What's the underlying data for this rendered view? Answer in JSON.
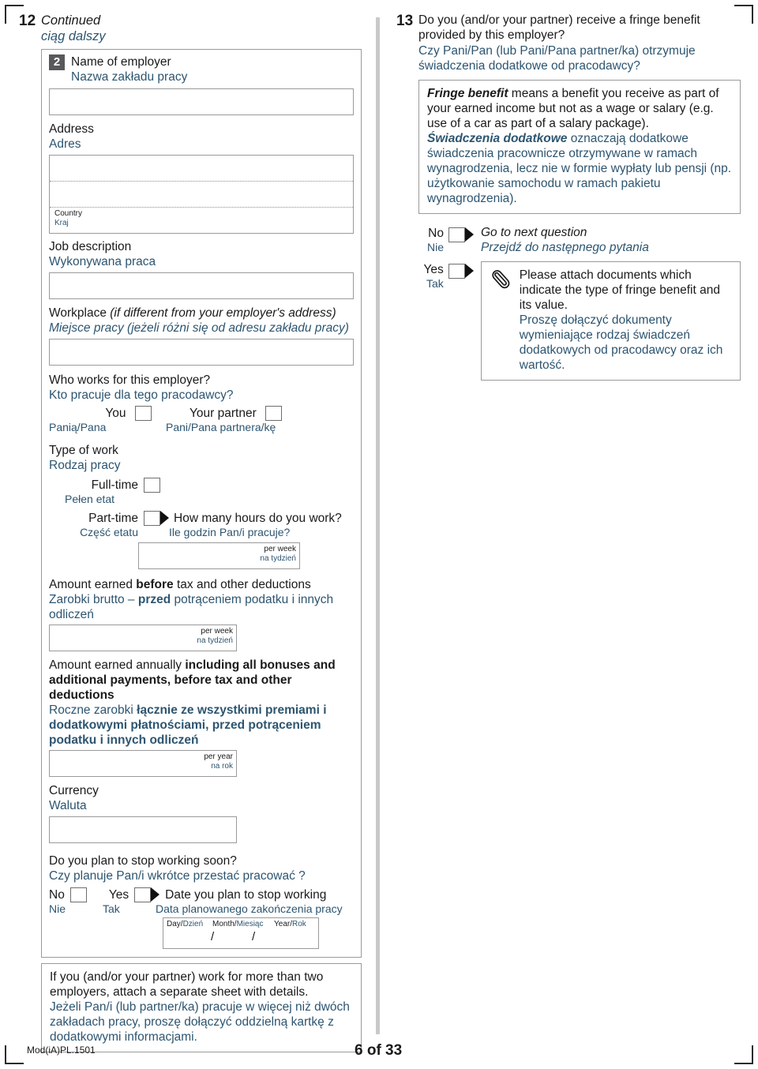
{
  "page": {
    "form_code": "Mod(iA)PL.1501",
    "page_label": "6 of 33"
  },
  "question12": {
    "number": "12",
    "title_en": "Continued",
    "title_pl": "ciąg dalszy",
    "sub_number": "2",
    "employer_name_en": "Name of employer",
    "employer_name_pl": "Nazwa zakładu pracy",
    "address_en": "Address",
    "address_pl": "Adres",
    "country_en": "Country",
    "country_pl": "Kraj",
    "job_description_en": "Job description",
    "job_description_pl": "Wykonywana praca",
    "workplace_en_bold": "Workplace",
    "workplace_en_italic": "(if different from your employer's address)",
    "workplace_pl": "Miejsce pracy (jeżeli różni się od adresu zakładu pracy)",
    "who_works_en": "Who works for this employer?",
    "who_works_pl": "Kto pracuje dla tego pracodawcy?",
    "you_en": "You",
    "you_pl": "Panią/Pana",
    "partner_en": "Your partner",
    "partner_pl": "Pani/Pana partnera/kę",
    "type_of_work_en": "Type of work",
    "type_of_work_pl": "Rodzaj pracy",
    "fulltime_en": "Full-time",
    "fulltime_pl": "Pełen etat",
    "parttime_en": "Part-time",
    "parttime_pl": "Część etatu",
    "hours_q_en": "How many hours do you work?",
    "hours_q_pl": "Ile godzin Pan/i pracuje?",
    "per_week_en": "per week",
    "per_week_pl": "na tydzień",
    "before_tax_en_1": "Amount earned ",
    "before_tax_en_bold": "before",
    "before_tax_en_2": " tax and other deductions",
    "before_tax_pl_1": "Zarobki brutto – ",
    "before_tax_pl_bold": "przed",
    "before_tax_pl_2": " potrąceniem podatku i innych odliczeń",
    "annual_en_1": "Amount earned annually ",
    "annual_en_bold": "including all bonuses and additional payments, before tax and other deductions",
    "annual_pl_1": "Roczne zarobki ",
    "annual_pl_bold": "łącznie ze wszystkimi premiami i dodatkowymi płatnościami, przed potrąceniem podatku i innych odliczeń",
    "per_year_en": "per year",
    "per_year_pl": "na rok",
    "currency_en": "Currency",
    "currency_pl": "Waluta",
    "stop_q_en": "Do you plan to stop working soon?",
    "stop_q_pl": "Czy planuje Pan/i wkrótce przestać pracować ?",
    "no_en": "No",
    "no_pl": "Nie",
    "yes_en": "Yes",
    "yes_pl": "Tak",
    "stop_date_en": "Date you plan to stop working",
    "stop_date_pl": "Data planowanego zakończenia pracy",
    "day_en": "Day/",
    "day_pl": "Dzień",
    "month_en": "Month/",
    "month_pl": "Miesiąc",
    "year_en": "Year/",
    "year_pl": "Rok",
    "date_slash_1": "/",
    "date_slash_2": "/",
    "note_en": "If you (and/or your partner) work for more than two employers, attach a separate sheet with details.",
    "note_pl": "Jeżeli Pan/i (lub partner/ka) pracuje w więcej niż dwóch zakładach pracy, proszę dołączyć oddzielną kartkę z dodatkowymi informacjami."
  },
  "question13": {
    "number": "13",
    "question_en": "Do you (and/or your partner) receive a fringe benefit provided by this employer?",
    "question_pl": "Czy Pani/Pan (lub Pani/Pana partner/ka) otrzymuje świadczenia dodatkowe od pracodawcy?",
    "def_en_bold": "Fringe benefit",
    "def_en_rest": " means a benefit you receive as part of your earned income but not as a wage or salary (e.g. use of a car as part of a salary package).",
    "def_pl_bold": "Świadczenia dodatkowe",
    "def_pl_rest": " oznaczają dodatkowe świadczenia pracownicze otrzymywane w ramach wynagrodzenia, lecz nie w formie wypłaty lub pensji (np. użytkowanie samochodu w ramach pakietu wynagrodzenia).",
    "no_en": "No",
    "no_pl": "Nie",
    "yes_en": "Yes",
    "yes_pl": "Tak",
    "goto_en": "Go to next question",
    "goto_pl": "Przejdź do następnego pytania",
    "attach_en": "Please attach documents which indicate the type of fringe benefit and its value.",
    "attach_pl": "Proszę dołączyć dokumenty wymieniające rodzaj świadczeń dodatkowych od pracodawcy oraz ich wartość."
  },
  "colors": {
    "polish_text": "#2d5570",
    "badge_bg": "#59595b",
    "border": "#9a9a9a",
    "divider": "#c9c9c9"
  }
}
